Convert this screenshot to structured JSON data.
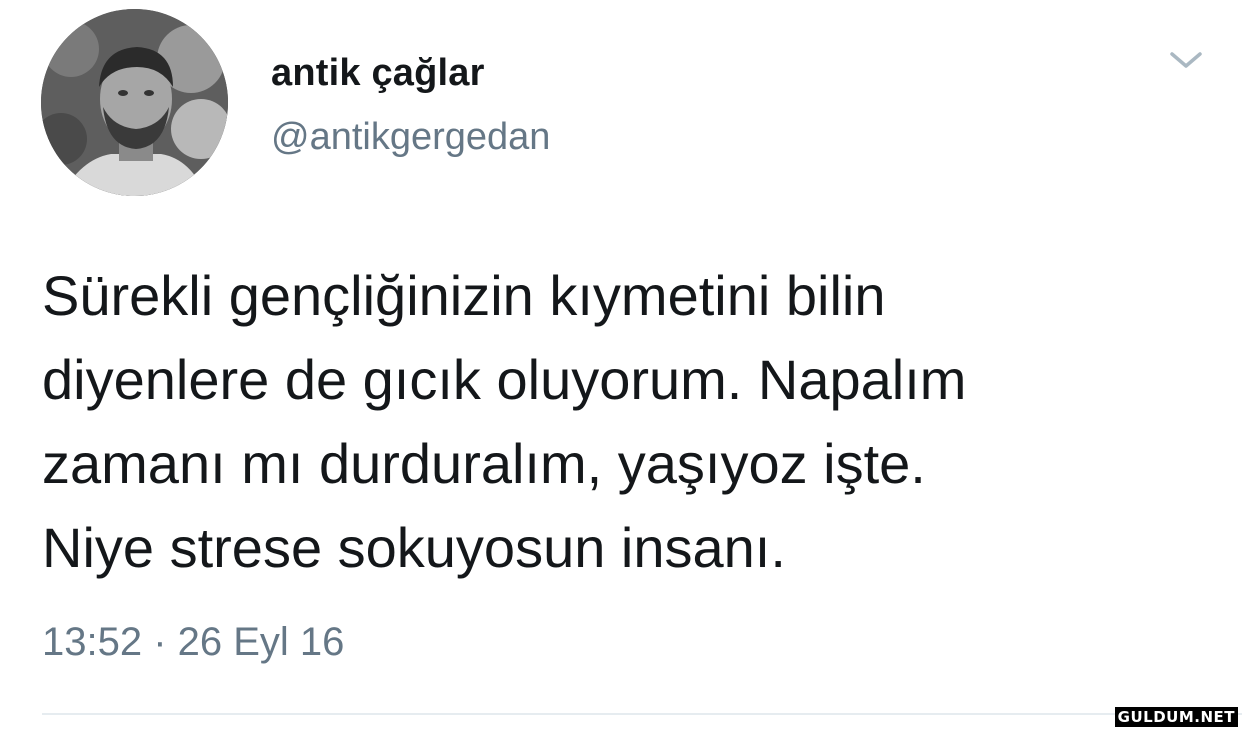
{
  "user": {
    "display_name": "antik çağlar",
    "handle": "@antikgergedan",
    "avatar_icon": "profile-photo"
  },
  "header": {
    "menu_icon": "chevron-down-icon"
  },
  "tweet": {
    "lines": [
      "Sürekli gençliğinizin kıymetini bilin",
      "diyenlere de gıcık oluyorum. Napalım",
      "zamanı mı durduralım, yaşıyoz işte.",
      "Niye strese sokuyosun insanı."
    ],
    "timestamp": "13:52 · 26 Eyl 16"
  },
  "watermark": {
    "text": "GULDUM.NET"
  },
  "colors": {
    "text": "#14171a",
    "secondary": "#657786",
    "divider": "#e6ecf0"
  }
}
